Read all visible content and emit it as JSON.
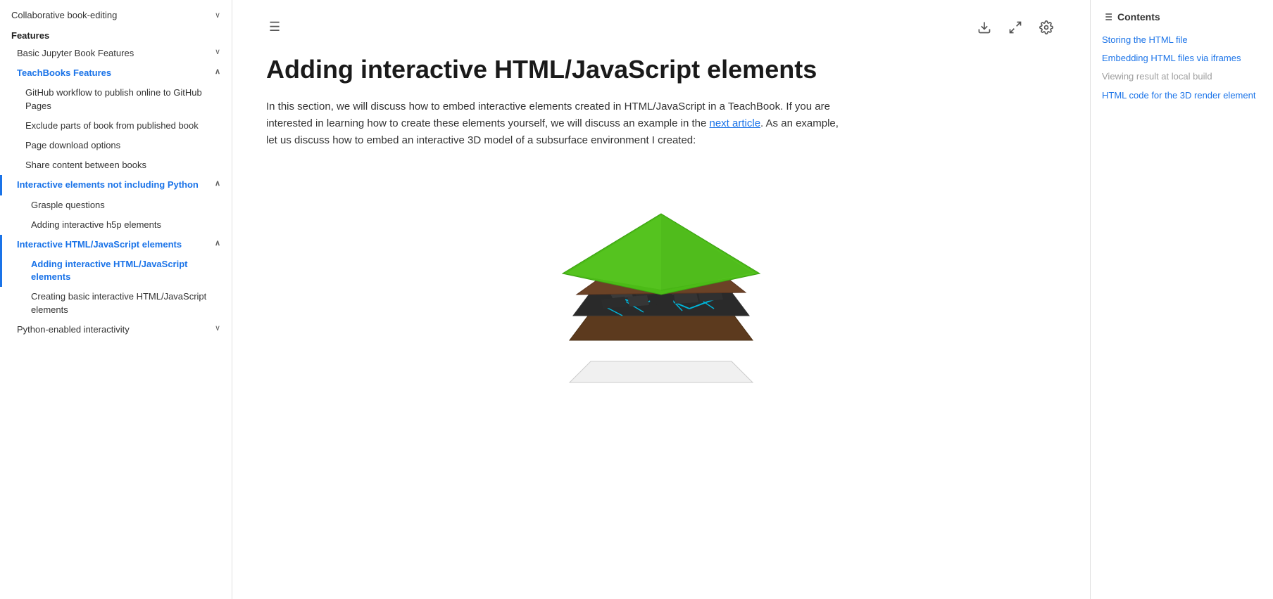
{
  "sidebar": {
    "top_item": "Collaborative book-editing",
    "section_label": "Features",
    "items": [
      {
        "label": "Basic Jupyter Book Features",
        "indent": 1,
        "has_chevron": true,
        "chevron": "∨",
        "active": false,
        "active_border": false
      },
      {
        "label": "TeachBooks Features",
        "indent": 1,
        "has_chevron": true,
        "chevron": "∧",
        "active": true,
        "active_border": false
      },
      {
        "label": "GitHub workflow to publish online to GitHub Pages",
        "indent": 2,
        "has_chevron": false,
        "active": false,
        "active_border": false
      },
      {
        "label": "Exclude parts of book from published book",
        "indent": 2,
        "has_chevron": false,
        "active": false,
        "active_border": false
      },
      {
        "label": "Page download options",
        "indent": 2,
        "has_chevron": false,
        "active": false,
        "active_border": false
      },
      {
        "label": "Share content between books",
        "indent": 2,
        "has_chevron": false,
        "active": false,
        "active_border": false
      },
      {
        "label": "Interactive elements not including Python",
        "indent": 2,
        "has_chevron": true,
        "chevron": "∧",
        "active": true,
        "active_border": true
      },
      {
        "label": "Grasple questions",
        "indent": 3,
        "has_chevron": false,
        "active": false,
        "active_border": false
      },
      {
        "label": "Adding interactive h5p elements",
        "indent": 3,
        "has_chevron": false,
        "active": false,
        "active_border": false
      },
      {
        "label": "Interactive HTML/JavaScript elements",
        "indent": 2,
        "has_chevron": true,
        "chevron": "∧",
        "active": true,
        "active_border": true
      },
      {
        "label": "Adding interactive HTML/JavaScript elements",
        "indent": 3,
        "has_chevron": false,
        "active": true,
        "active_border": true
      },
      {
        "label": "Creating basic interactive HTML/JavaScript elements",
        "indent": 3,
        "has_chevron": false,
        "active": false,
        "active_border": false
      },
      {
        "label": "Python-enabled interactivity",
        "indent": 1,
        "has_chevron": true,
        "chevron": "∨",
        "active": false,
        "active_border": false
      }
    ]
  },
  "toolbar": {
    "menu_icon": "☰",
    "download_icon": "⬇",
    "fullscreen_icon": "⛶",
    "settings_icon": "⚙"
  },
  "main": {
    "title": "Adding interactive HTML/JavaScript elements",
    "body_text": "In this section, we will discuss how to embed interactive elements created in HTML/JavaScript in a TeachBook. If you are interested in learning how to create these elements yourself, we will discuss an example in the ",
    "link1_text": "next article",
    "body_text2": ". As an example, let us discuss how to embed an interactive 3D model of a subsurface environment I created:"
  },
  "toc": {
    "title": "Contents",
    "items": [
      {
        "label": "Storing the HTML file",
        "active": false
      },
      {
        "label": "Embedding HTML files via iframes",
        "active": false
      },
      {
        "label": "Viewing result at local build",
        "active": true
      },
      {
        "label": "HTML code for the 3D render element",
        "active": false
      }
    ]
  },
  "colors": {
    "active_blue": "#1a73e8",
    "sidebar_bg": "#ffffff",
    "content_bg": "#ffffff"
  }
}
